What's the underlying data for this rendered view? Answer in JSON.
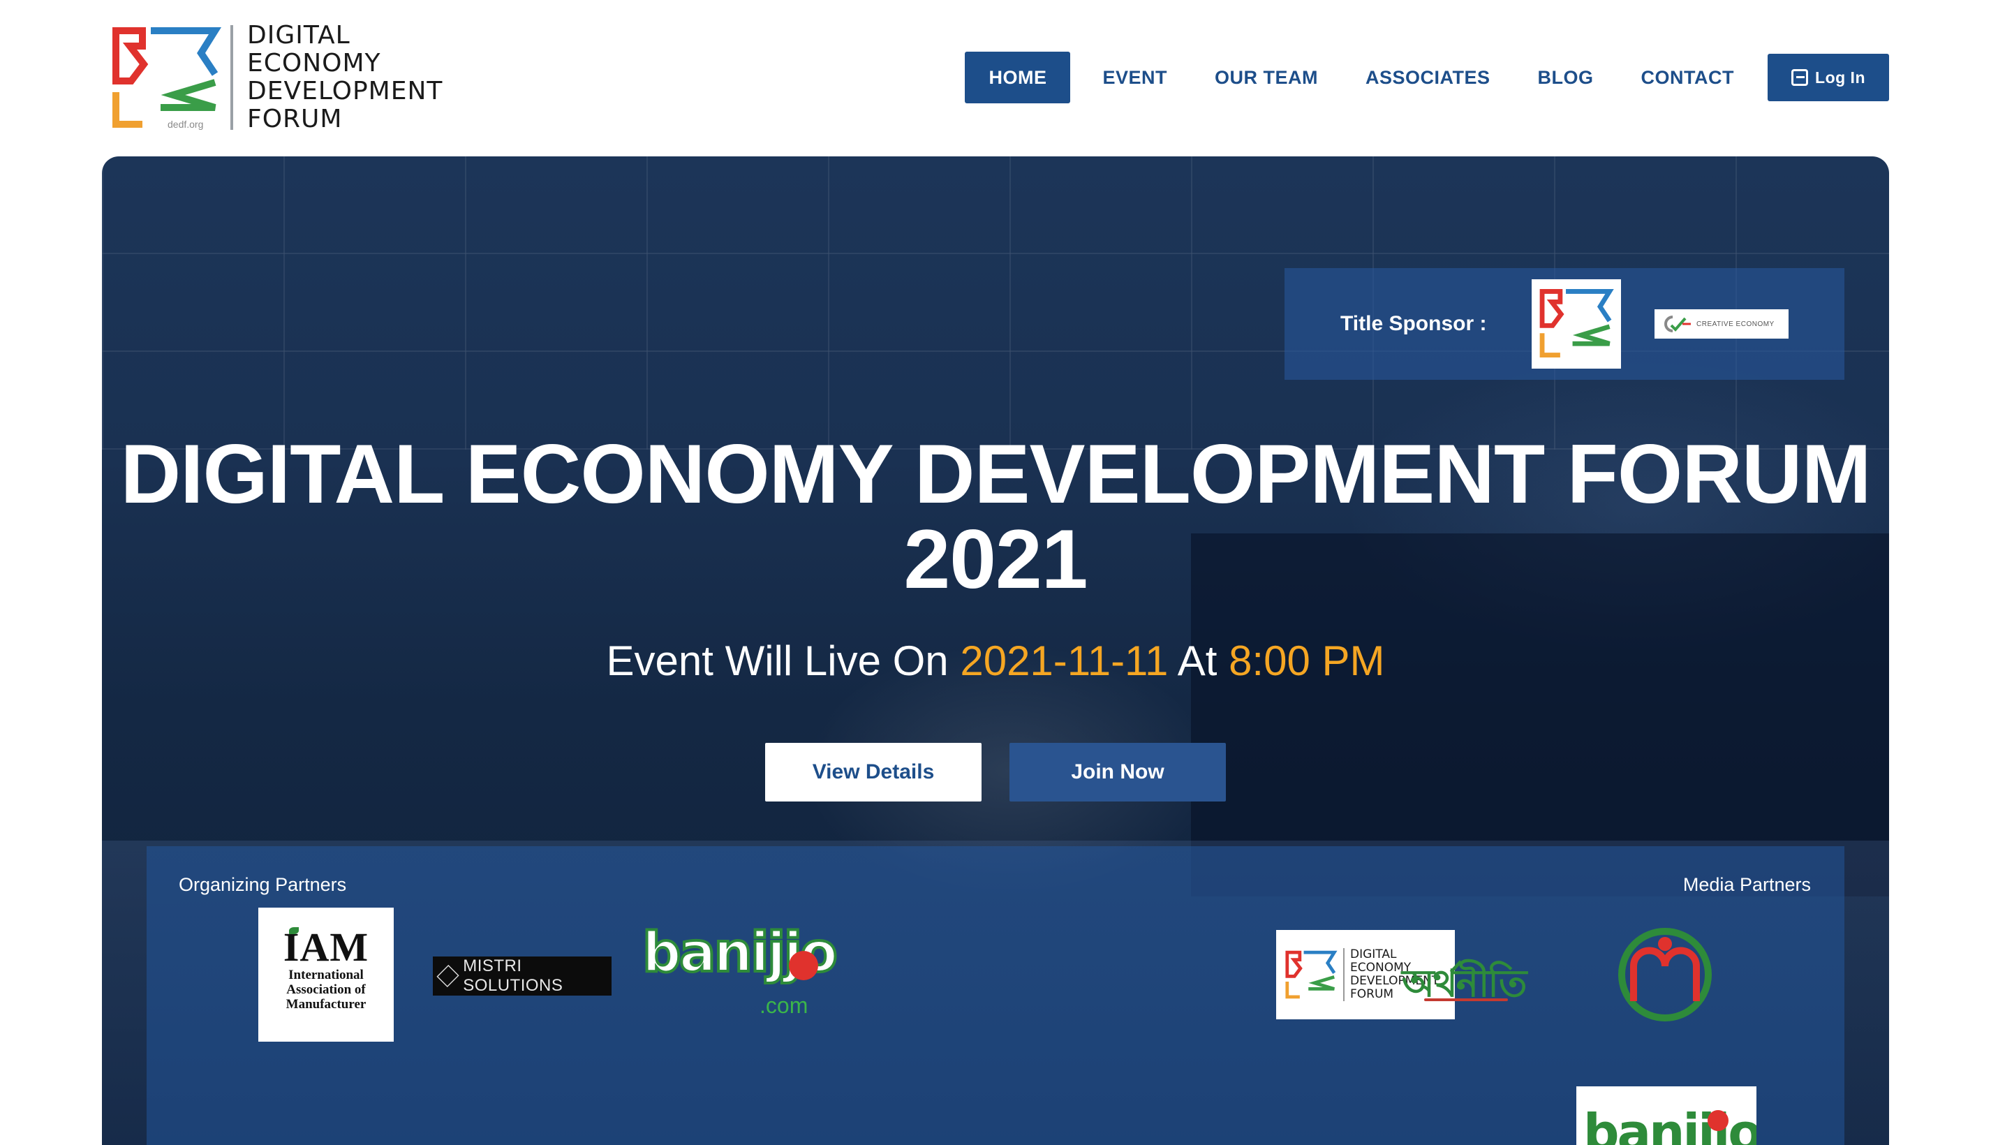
{
  "brand": {
    "logo_lines": [
      "DIGITAL",
      "ECONOMY",
      "DEVELOPMENT",
      "FORUM"
    ],
    "logo_url": "dedf.org",
    "colors": {
      "primary": "#1d4e8a",
      "accent_orange": "#f5a623",
      "logo_red": "#e0322d",
      "logo_blue": "#2a7fc4",
      "logo_green": "#3a9d48",
      "logo_orange": "#f0a030"
    }
  },
  "nav": {
    "items": [
      {
        "label": "HOME",
        "active": true
      },
      {
        "label": "EVENT",
        "active": false
      },
      {
        "label": "OUR TEAM",
        "active": false
      },
      {
        "label": "ASSOCIATES",
        "active": false
      },
      {
        "label": "BLOG",
        "active": false
      },
      {
        "label": "CONTACT",
        "active": false
      }
    ],
    "login_label": "Log In",
    "login_icon": "login-icon"
  },
  "hero": {
    "sponsor_label": "Title Sponsor :",
    "sponsor_logo2_text": "CREATIVE ECONOMY",
    "title_line1": "DIGITAL ECONOMY DEVELOPMENT FORUM",
    "title_line2": "2021",
    "sub_prefix": "Event Will Live On ",
    "sub_date": "2021-11-11",
    "sub_mid": " At ",
    "sub_time": "8:00 PM",
    "btn_details": "View Details",
    "btn_join": "Join Now"
  },
  "partners": {
    "organizing_label": "Organizing Partners",
    "media_label": "Media Partners",
    "iam_big": "IAM",
    "iam_small": [
      "International",
      "Association of",
      "Manufacturer"
    ],
    "mistri_text": "MISTRI SOLUTIONS",
    "banijjo_text": "banijjo",
    "banijjo_com": ".com",
    "dedf_lines": [
      "DIGITAL",
      "ECONOMY",
      "DEVELOPMENT",
      "FORUM"
    ],
    "akhr_text": "অর্থনীতি",
    "banijjo2_text": "banijjo"
  }
}
